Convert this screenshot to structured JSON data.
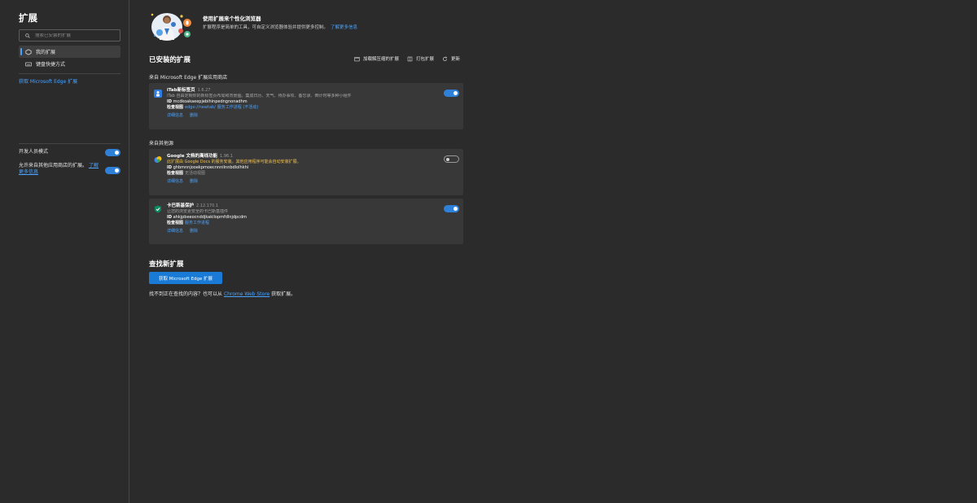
{
  "sidebar": {
    "title": "扩展",
    "search_placeholder": "搜索已安装的扩展",
    "items": [
      {
        "label": "我的扩展",
        "icon": "extension-icon"
      },
      {
        "label": "键盘快捷方式",
        "icon": "keyboard-icon"
      }
    ],
    "get_extensions_link": "获取 Microsoft Edge 扩展",
    "dev_mode": {
      "label": "开发人员模式",
      "on": true
    },
    "allow_other_stores": {
      "label": "允许来自其他应用商店的扩展。",
      "link": "了解更多信息",
      "on": true
    }
  },
  "hero": {
    "title": "使用扩展来个性化浏览器",
    "description": "扩展程序是简单的工具，可自定义浏览器体验并提供更多控制。",
    "link": "了解更多信息"
  },
  "installed": {
    "title": "已安装的扩展",
    "toolbar": {
      "load_unpacked": "加载解压缩的扩展",
      "pack": "打包扩展",
      "update": "更新"
    },
    "sections": [
      {
        "label": "来自 Microsoft Edge 扩展应用商店",
        "extensions": [
          {
            "name": "iTab新标签页",
            "version": "1.6.27",
            "desc": "iTab 自由定制你的新标签页布局和背景图。集成日历、天气、待办事项、备忘录、倒计时等多种小组件",
            "warning": "",
            "id_label": "ID",
            "id": "mcdkoakaeepjebihinpedngnonadhm",
            "inspect_label": "检查视图",
            "inspect_value": "edge://newtab/",
            "inspect_extra": "服务工作进程 (不活动)",
            "actions": [
              "详细信息",
              "删除"
            ],
            "enabled": true,
            "icon_color": "#2f7de1"
          }
        ]
      },
      {
        "label": "来自其他源",
        "extensions": [
          {
            "name": "Google 文档的离线功能",
            "version": "1.96.1",
            "desc": "",
            "warning": "此扩展由 Google Docs 的服务安装。其他应用程序可能会自动安装扩展。",
            "id_label": "ID",
            "id": "ghbmnnjooekpmoecnnnilnnbdlolhkhi",
            "inspect_label": "检查视图",
            "inspect_value": "",
            "inspect_extra": "无活动视图",
            "actions": [
              "详细信息",
              "删除"
            ],
            "enabled": false,
            "icon_color": "#4285f4"
          },
          {
            "name": "卡巴斯基保护",
            "version": "2.12.170.1",
            "desc": "让您的浏览更安全的卡巴斯基插件",
            "warning": "",
            "id_label": "ID",
            "id": "ahkjpbeeocnddjkakilopmfdlnjdpcdm",
            "inspect_label": "检查视图",
            "inspect_value": "服务工作进程",
            "inspect_extra": "",
            "actions": [
              "详细信息",
              "删除"
            ],
            "enabled": true,
            "icon_color": "#0e8a5f"
          }
        ]
      }
    ]
  },
  "find": {
    "title": "查找新扩展",
    "button": "获取 Microsoft Edge 扩展",
    "note_prefix": "找不到正在查找的内容？也可以从",
    "note_link": "Chrome Web Store",
    "note_suffix": "获取扩展。"
  }
}
